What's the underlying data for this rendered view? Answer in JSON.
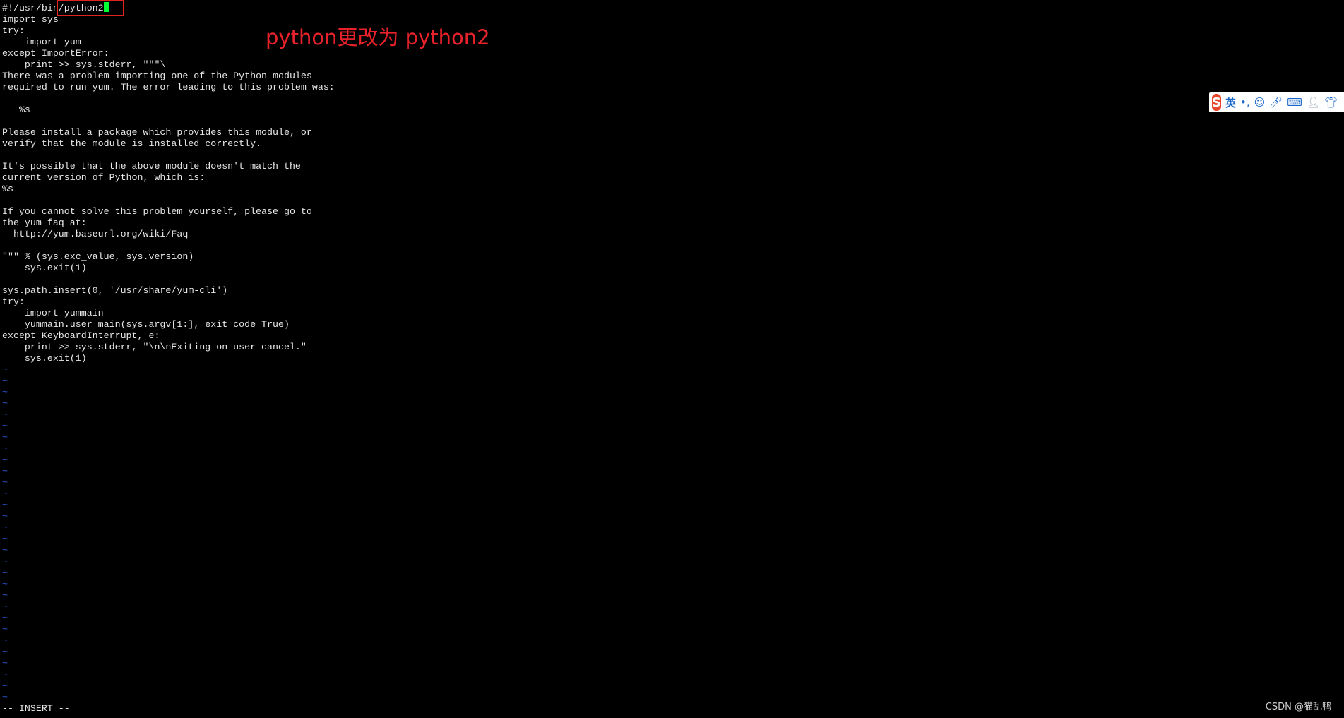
{
  "editor": {
    "lines": [
      "#!/usr/bin/python2",
      "import sys",
      "try:",
      "    import yum",
      "except ImportError:",
      "    print >> sys.stderr, \"\"\"\\",
      "There was a problem importing one of the Python modules",
      "required to run yum. The error leading to this problem was:",
      "",
      "   %s",
      "",
      "Please install a package which provides this module, or",
      "verify that the module is installed correctly.",
      "",
      "It's possible that the above module doesn't match the",
      "current version of Python, which is:",
      "%s",
      "",
      "If you cannot solve this problem yourself, please go to",
      "the yum faq at:",
      "  http://yum.baseurl.org/wiki/Faq",
      "",
      "\"\"\" % (sys.exc_value, sys.version)",
      "    sys.exit(1)",
      "",
      "sys.path.insert(0, '/usr/share/yum-cli')",
      "try:",
      "    import yummain",
      "    yummain.user_main(sys.argv[1:], exit_code=True)",
      "except KeyboardInterrupt, e:",
      "    print >> sys.stderr, \"\\n\\nExiting on user cancel.\"",
      "    sys.exit(1)"
    ],
    "empty_line_marker": "~",
    "empty_line_count": 30
  },
  "status_line": "-- INSERT --",
  "annotation": "python更改为 python2",
  "ime": {
    "logo": "S",
    "lang": "英",
    "punct": "•,",
    "icons": [
      "smiley-icon",
      "microphone-icon",
      "keyboard-icon",
      "user-icon",
      "skin-icon"
    ]
  },
  "watermark": "CSDN @猫乱鸭",
  "colors": {
    "background": "#000000",
    "text": "#e6e6e6",
    "tilde": "#2f55d4",
    "cursor": "#00ff33",
    "annotation": "#e8222a"
  }
}
